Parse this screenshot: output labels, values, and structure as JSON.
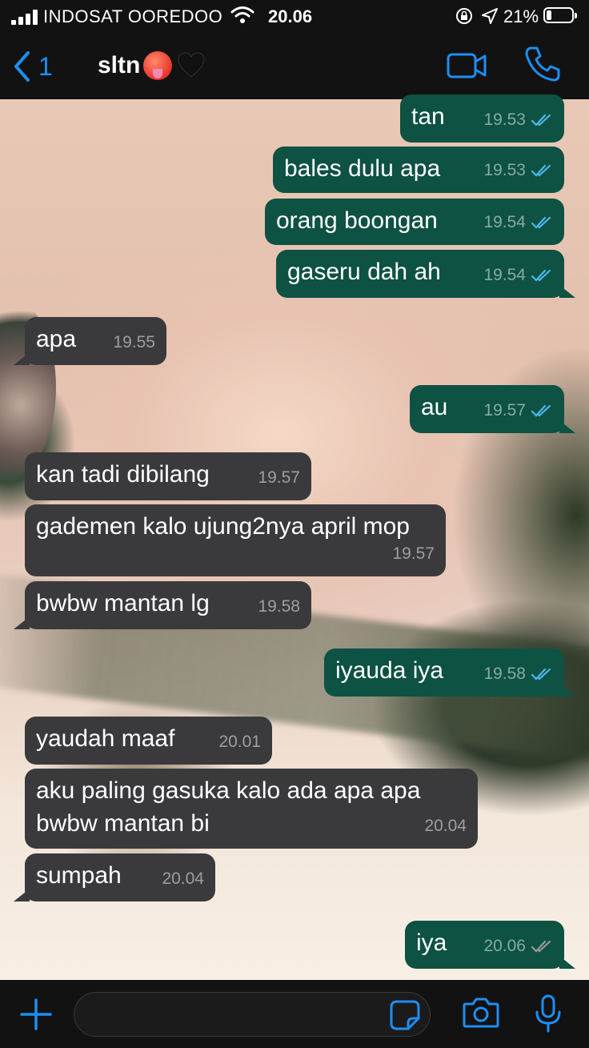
{
  "status_bar": {
    "carrier": "INDOSAT OOREDOO",
    "time": "20.06",
    "battery_pct_text": "21%",
    "battery_level": 0.21
  },
  "header": {
    "back_count": "1",
    "contact_name": "sltn",
    "name_emojis": [
      "hot-face-emoji",
      "black-heart-emoji"
    ],
    "accent_color": "#1e8ef3"
  },
  "messages": [
    {
      "dir": "out",
      "text": "tan",
      "time": "19.53",
      "status": "read"
    },
    {
      "dir": "out",
      "text": "bales dulu apa",
      "time": "19.53",
      "status": "read"
    },
    {
      "dir": "out",
      "text": "orang boongan",
      "time": "19.54",
      "status": "read"
    },
    {
      "dir": "out",
      "text": "gaseru dah ah",
      "time": "19.54",
      "status": "read"
    },
    {
      "dir": "in",
      "text": "apa",
      "time": "19.55"
    },
    {
      "dir": "out",
      "text": "au",
      "time": "19.57",
      "status": "read"
    },
    {
      "dir": "in",
      "text": "kan tadi dibilang",
      "time": "19.57"
    },
    {
      "dir": "in",
      "text": "gademen kalo ujung2nya april mop",
      "time": "19.57"
    },
    {
      "dir": "in",
      "text": "bwbw mantan lg",
      "time": "19.58"
    },
    {
      "dir": "out",
      "text": "iyauda iya",
      "time": "19.58",
      "status": "read"
    },
    {
      "dir": "in",
      "text": "yaudah maaf",
      "time": "20.01"
    },
    {
      "dir": "in",
      "text_line1": "aku paling gasuka kalo ada apa apa",
      "text_line2": "bwbw mantan bi",
      "time": "20.04"
    },
    {
      "dir": "in",
      "text": "sumpah",
      "time": "20.04"
    },
    {
      "dir": "out",
      "text": "iya",
      "time": "20.06",
      "status": "delivered"
    }
  ],
  "colors": {
    "outgoing_bubble": "#0d5243",
    "incoming_bubble": "#3a3a3c",
    "read_tick": "#4fb6ec",
    "delivered_tick": "#9a9a9a"
  },
  "input_bar": {
    "icons": [
      "plus-icon",
      "sticker-icon",
      "camera-icon",
      "microphone-icon"
    ]
  }
}
